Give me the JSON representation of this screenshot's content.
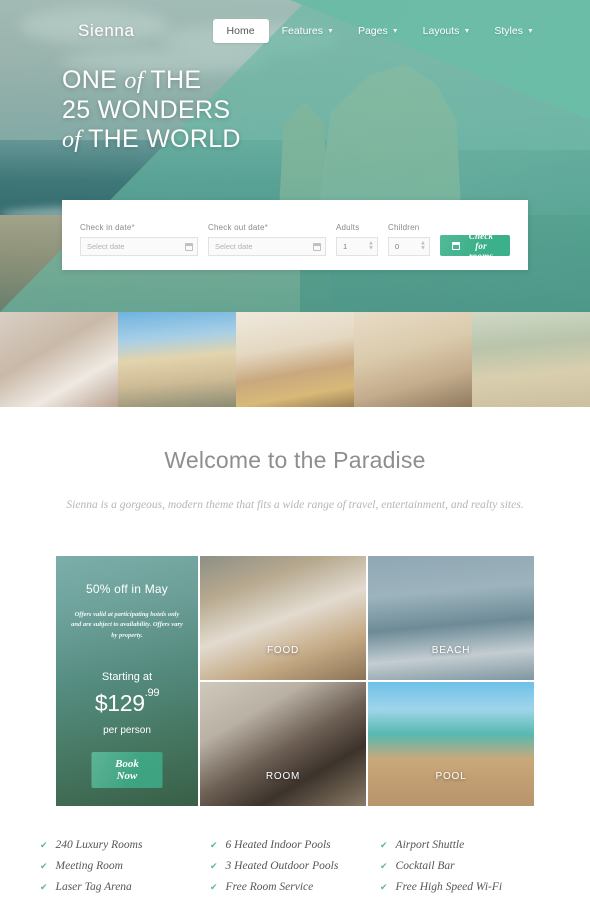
{
  "nav": {
    "logo": "Sienna",
    "items": [
      {
        "label": "Home",
        "caret": false,
        "active": true
      },
      {
        "label": "Features",
        "caret": true,
        "active": false
      },
      {
        "label": "Pages",
        "caret": true,
        "active": false
      },
      {
        "label": "Layouts",
        "caret": true,
        "active": false
      },
      {
        "label": "Styles",
        "caret": true,
        "active": false
      }
    ],
    "caret_glyph": "▼"
  },
  "hero": {
    "line1_a": "ONE",
    "line1_it": "of",
    "line1_b": "THE",
    "line2": "25 WONDERS",
    "line3_it": "of",
    "line3_b": "THE WORLD"
  },
  "booking": {
    "checkin_label": "Check in date",
    "checkout_label": "Check out date",
    "required_mark": "*",
    "checkin_placeholder": "Select date",
    "checkout_placeholder": "Select date",
    "adults_label": "Adults",
    "adults_value": "1",
    "children_label": "Children",
    "children_value": "0",
    "submit_label": "Check for rooms",
    "spinner_up": "▲",
    "spinner_down": "▼"
  },
  "welcome": {
    "heading": "Welcome to the Paradise",
    "subtitle": "Sienna is a gorgeous, modern theme that fits a wide range of travel, entertainment, and realty sites."
  },
  "promo": {
    "title": "50% off in May",
    "fine_print": "Offers valid at participating hotels only and are subject to availability. Offers vary by property.",
    "starting_label": "Starting at",
    "price_main": "$129",
    "price_cents": ".99",
    "per_label": "per person",
    "button_label": "Book Now"
  },
  "gallery": {
    "tiles": [
      {
        "label": "FOOD"
      },
      {
        "label": "BEACH"
      },
      {
        "label": "ROOM"
      },
      {
        "label": "POOL"
      }
    ]
  },
  "features": {
    "check_glyph": "✔",
    "columns": [
      {
        "items": [
          "240 Luxury Rooms",
          "Meeting Room",
          "Laser Tag Arena"
        ]
      },
      {
        "items": [
          "6 Heated Indoor Pools",
          "3 Heated Outdoor Pools",
          "Free Room Service"
        ]
      },
      {
        "items": [
          "Airport Shuttle",
          "Cocktail Bar",
          "Free High Speed Wi-Fi"
        ]
      }
    ]
  },
  "colors": {
    "teal_overlay": "#76c4ae",
    "button_green": "#3cb08a",
    "check_green": "#5bb98c",
    "heading_gray": "#8e8e8e",
    "subtitle_gray": "#b6b6b6"
  }
}
